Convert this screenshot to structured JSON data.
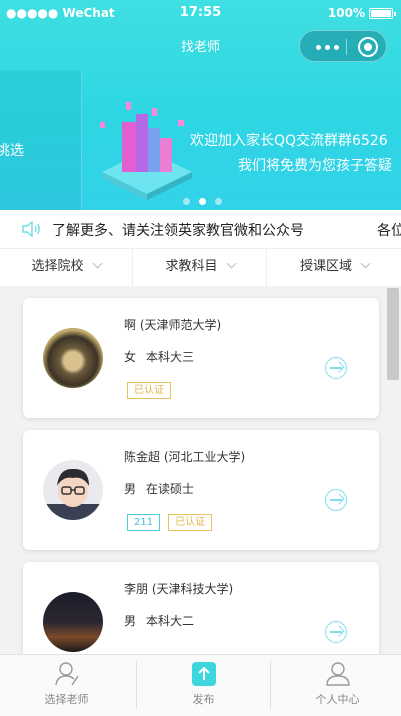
{
  "status_bar": {
    "carrier": "●●●●● WeChat",
    "time": "17:55",
    "battery": "100%"
  },
  "nav": {
    "title": "找老师"
  },
  "banner": {
    "left_text": "挑选",
    "line1": "欢迎加入家长QQ交流群群6526",
    "line2": "我们将免费为您孩子答疑"
  },
  "notice": {
    "text": "了解更多、请关注领英家教官微和公众号",
    "text2": "各位"
  },
  "filters": [
    {
      "label": "选择院校"
    },
    {
      "label": "求教科目"
    },
    {
      "label": "授课区域"
    }
  ],
  "teachers": [
    {
      "name": "啊 (天津师范大学)",
      "gender": "女",
      "degree": "本科大三",
      "tags": [
        "已认证"
      ]
    },
    {
      "name": "陈金超 (河北工业大学)",
      "gender": "男",
      "degree": "在读硕士",
      "tags": [
        "211",
        "已认证"
      ]
    },
    {
      "name": "李朋 (天津科技大学)",
      "gender": "男",
      "degree": "本科大二",
      "tags": []
    }
  ],
  "tabbar": [
    {
      "label": "选择老师"
    },
    {
      "label": "发布"
    },
    {
      "label": "个人中心"
    }
  ],
  "colors": {
    "accent": "#2ed6e3",
    "tag_yellow": "#e0b54a",
    "tag_blue": "#3cc3e0"
  }
}
